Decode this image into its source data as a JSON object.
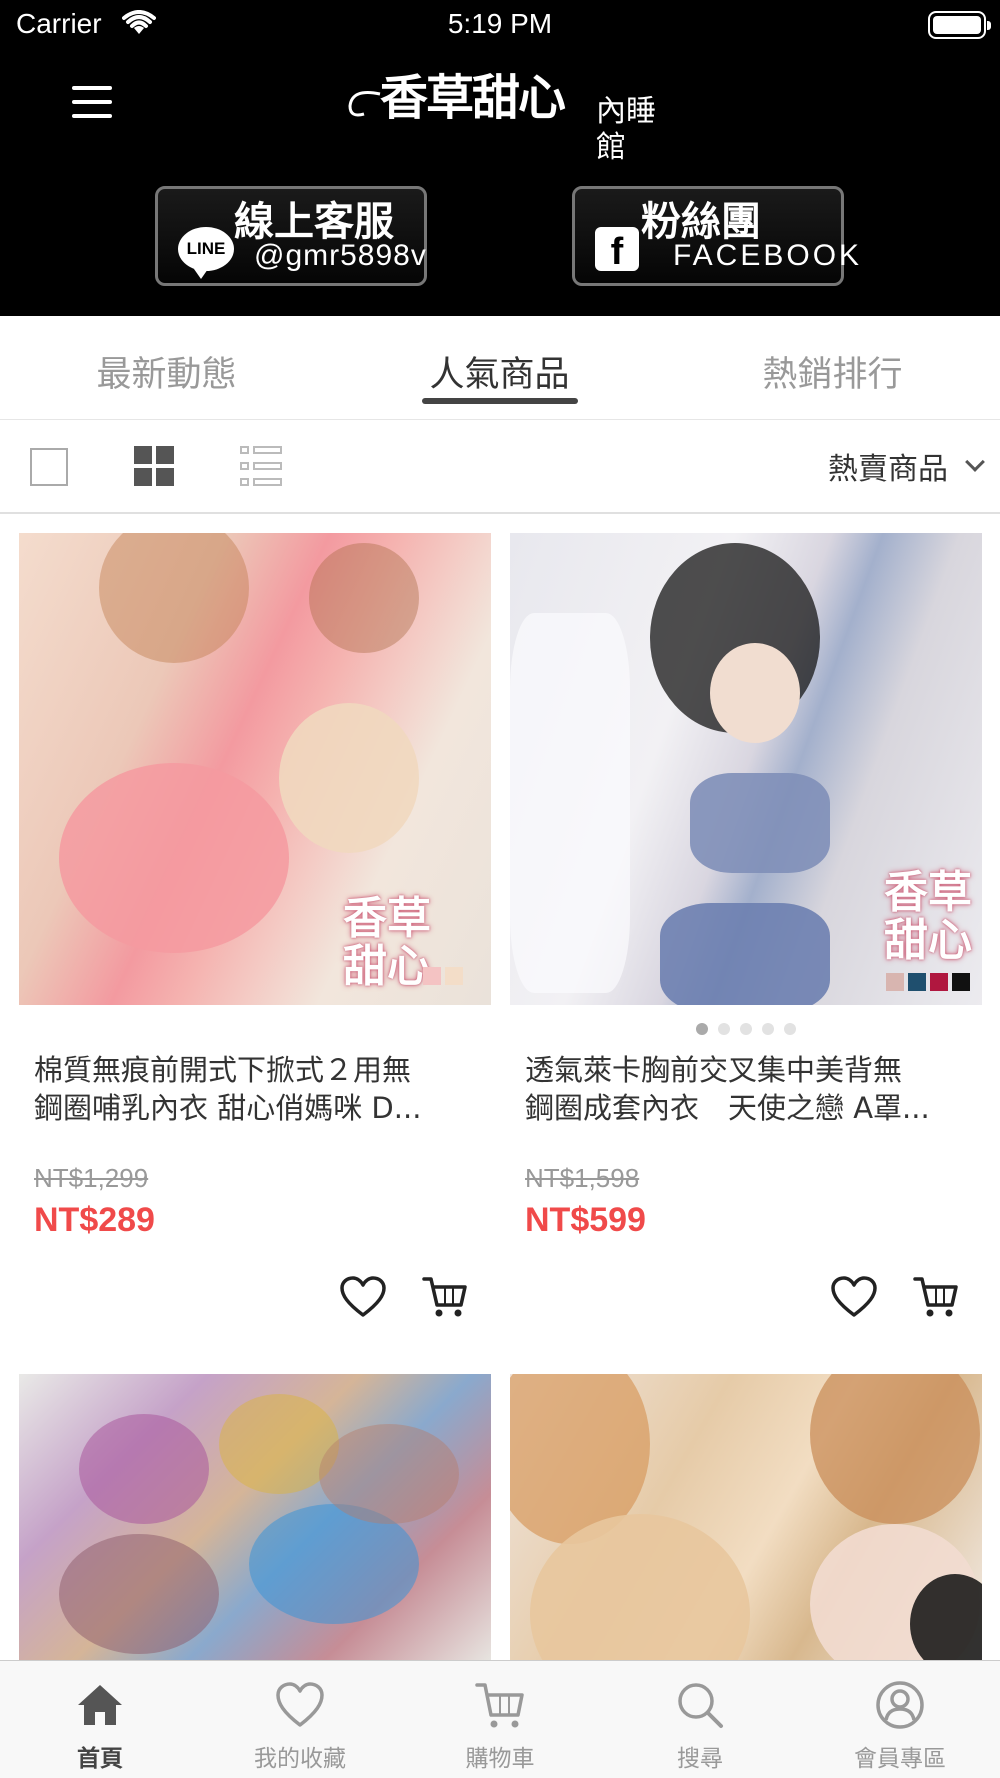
{
  "status_bar": {
    "carrier": "Carrier",
    "time": "5:19 PM"
  },
  "header": {
    "logo_main": "香草甜心",
    "logo_sub": "內睡館",
    "line_button": {
      "title": "線上客服",
      "subtitle": "@gmr5898v",
      "icon_text": "LINE"
    },
    "fb_button": {
      "title": "粉絲團",
      "subtitle": "FACEBOOK",
      "icon_text": "f"
    }
  },
  "tabs": [
    {
      "label": "最新動態",
      "active": false
    },
    {
      "label": "人氣商品",
      "active": true
    },
    {
      "label": "熱銷排行",
      "active": false
    }
  ],
  "toolbar": {
    "view_modes": [
      "single",
      "grid",
      "list"
    ],
    "active_view": "grid",
    "sort_selected": "熱賣商品"
  },
  "products": [
    {
      "name_line1": "棉質無痕前開式下掀式２用無",
      "name_line2": "鋼圈哺乳內衣 甜心俏媽咪 D...",
      "original_price": "NT$1,299",
      "sale_price": "NT$289",
      "watermark_line1": "香草",
      "watermark_line2": "甜心",
      "swatches": [
        "#f4c3c3",
        "#f3ddc8"
      ]
    },
    {
      "name_line1": "透氣萊卡胸前交叉集中美背無",
      "name_line2": "鋼圈成套內衣　天使之戀 A罩...",
      "original_price": "NT$1,598",
      "sale_price": "NT$599",
      "watermark_line1": "香草",
      "watermark_line2": "甜心",
      "swatches": [
        "#d8b5b0",
        "#1f4f6e",
        "#b0173f",
        "#111111"
      ],
      "carousel_dots": 5,
      "carousel_active": 0
    },
    {
      "image": "dried-flower-sachets"
    },
    {
      "image": "lingerie-model"
    }
  ],
  "tabbar": [
    {
      "label": "首頁",
      "icon": "home-icon",
      "active": true
    },
    {
      "label": "我的收藏",
      "icon": "heart-icon",
      "active": false
    },
    {
      "label": "購物車",
      "icon": "cart-icon",
      "active": false
    },
    {
      "label": "搜尋",
      "icon": "search-icon",
      "active": false
    },
    {
      "label": "會員專區",
      "icon": "user-icon",
      "active": false
    }
  ],
  "colors": {
    "header_bg": "#000000",
    "sale_price": "#f04a4a",
    "active_tab_underline": "#444444"
  }
}
